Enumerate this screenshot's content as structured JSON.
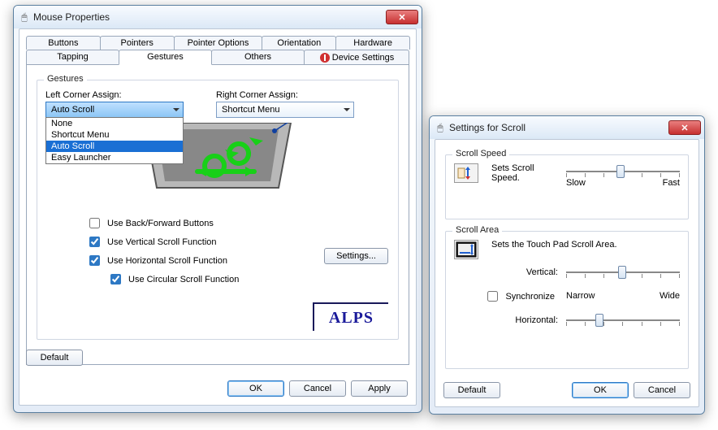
{
  "main": {
    "title": "Mouse Properties",
    "tabs_row1": [
      "Buttons",
      "Pointers",
      "Pointer Options",
      "Orientation",
      "Hardware"
    ],
    "tabs_row2": {
      "tapping": "Tapping",
      "gestures": "Gestures",
      "others": "Others",
      "device_settings": "Device Settings"
    },
    "group_label": "Gestures",
    "left_assign_label": "Left Corner Assign:",
    "right_assign_label": "Right Corner Assign:",
    "left_assign_value": "Auto Scroll",
    "right_assign_value": "Shortcut Menu",
    "left_assign_options": [
      "None",
      "Shortcut Menu",
      "Auto Scroll",
      "Easy Launcher"
    ],
    "left_assign_selected_index": 2,
    "chk_backforward": "Use Back/Forward Buttons",
    "chk_vscroll": "Use Vertical Scroll Function",
    "chk_hscroll": "Use Horizontal Scroll Function",
    "chk_circular": "Use Circular Scroll Function",
    "settings_btn": "Settings...",
    "default_btn": "Default",
    "ok_btn": "OK",
    "cancel_btn": "Cancel",
    "apply_btn": "Apply",
    "alps": "ALPS"
  },
  "scroll": {
    "title": "Settings for Scroll",
    "speed_group": "Scroll Speed",
    "speed_text": "Sets Scroll Speed.",
    "slow": "Slow",
    "fast": "Fast",
    "area_group": "Scroll Area",
    "area_text": "Sets the Touch Pad Scroll Area.",
    "vertical": "Vertical:",
    "horizontal": "Horizontal:",
    "synchronize": "Synchronize",
    "narrow": "Narrow",
    "wide": "Wide",
    "default_btn": "Default",
    "ok_btn": "OK",
    "cancel_btn": "Cancel"
  }
}
